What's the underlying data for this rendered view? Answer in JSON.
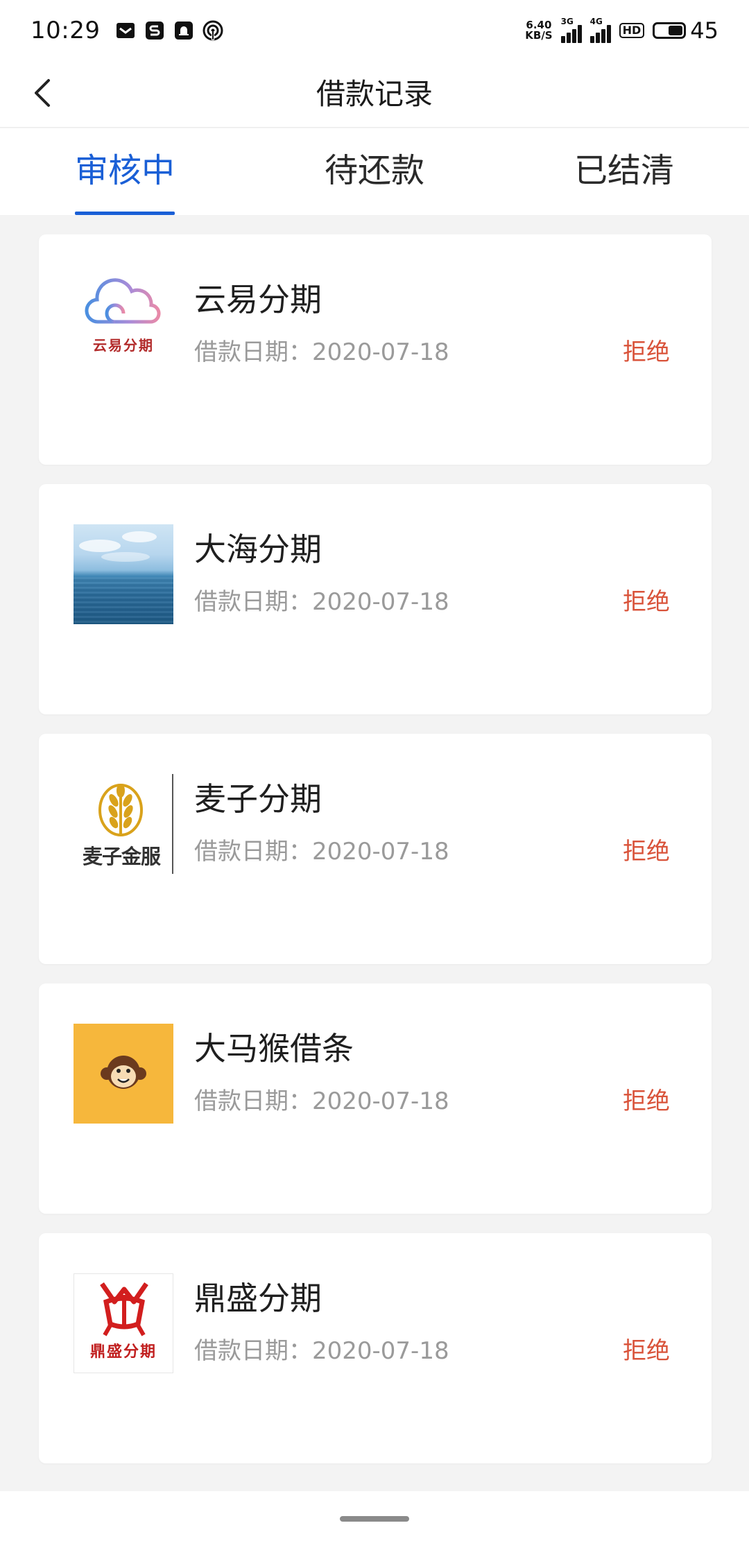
{
  "status_bar": {
    "time": "10:29",
    "net_speed_value": "6.40",
    "net_speed_unit": "KB/S",
    "sim1_type": "3G",
    "sim2_type": "4G",
    "hd_label": "HD",
    "battery": "45",
    "icons": [
      "message-icon",
      "s-app-icon",
      "notification-icon",
      "hotspot-icon"
    ]
  },
  "header": {
    "title": "借款记录",
    "back_icon": "chevron-left-icon"
  },
  "tabs": [
    {
      "label": "审核中",
      "active": true
    },
    {
      "label": "待还款",
      "active": false
    },
    {
      "label": "已结清",
      "active": false
    }
  ],
  "colors": {
    "accent": "#1a5fd6",
    "status_rejected": "#d9533a",
    "background": "#f3f3f3"
  },
  "records": [
    {
      "name": "云易分期",
      "date_label": "借款日期：",
      "date": "2020-07-18",
      "status": "拒绝",
      "logo": "cloud-logo",
      "logo_text": "云易分期"
    },
    {
      "name": "大海分期",
      "date_label": "借款日期：",
      "date": "2020-07-18",
      "status": "拒绝",
      "logo": "sea-logo"
    },
    {
      "name": "麦子分期",
      "date_label": "借款日期：",
      "date": "2020-07-18",
      "status": "拒绝",
      "logo": "wheat-logo",
      "logo_text": "麦子金服"
    },
    {
      "name": "大马猴借条",
      "date_label": "借款日期：",
      "date": "2020-07-18",
      "status": "拒绝",
      "logo": "monkey-logo"
    },
    {
      "name": "鼎盛分期",
      "date_label": "借款日期：",
      "date": "2020-07-18",
      "status": "拒绝",
      "logo": "dingsheng-logo",
      "logo_text": "鼎盛分期"
    }
  ]
}
